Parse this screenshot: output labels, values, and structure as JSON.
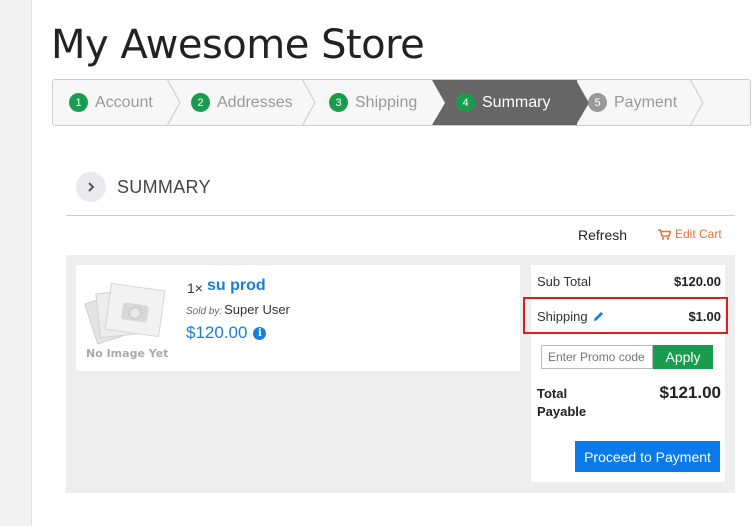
{
  "store": {
    "title": "My Awesome Store"
  },
  "steps": [
    {
      "num": "1",
      "label": "Account"
    },
    {
      "num": "2",
      "label": "Addresses"
    },
    {
      "num": "3",
      "label": "Shipping"
    },
    {
      "num": "4",
      "label": "Summary"
    },
    {
      "num": "5",
      "label": "Payment"
    }
  ],
  "summary": {
    "title": "SUMMARY",
    "refresh_label": "Refresh",
    "edit_cart_label": "Edit Cart"
  },
  "item": {
    "qty": "1×",
    "name": "su prod",
    "sold_by_label": "Sold by:",
    "seller": "Super User",
    "price": "$120.00",
    "no_image_text": "No Image Yet"
  },
  "totals": {
    "subtotal_label": "Sub Total",
    "subtotal_value": "$120.00",
    "shipping_label": "Shipping",
    "shipping_value": "$1.00",
    "promo_placeholder": "Enter Promo code",
    "apply_label": "Apply",
    "total_label_line1": "Total",
    "total_label_line2": "Payable",
    "total_value": "$121.00",
    "proceed_label": "Proceed to Payment"
  },
  "colors": {
    "green": "#1a9c4e",
    "blue": "#0a7ae8",
    "link_blue": "#1a7ed8",
    "orange": "#e5733a",
    "highlight_red": "#d9201f",
    "active_step": "#666666"
  }
}
